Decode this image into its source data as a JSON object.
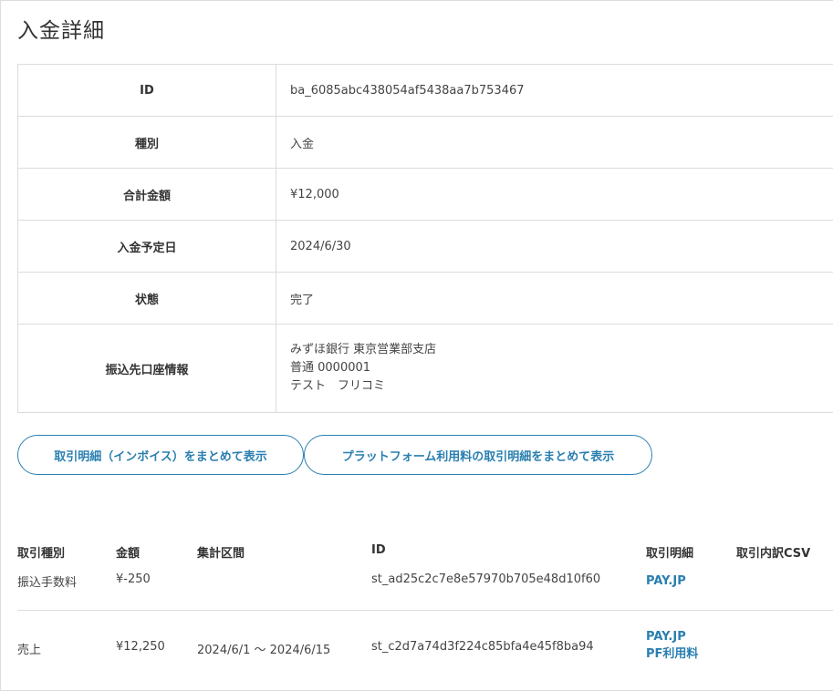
{
  "page": {
    "title": "入金詳細"
  },
  "details": {
    "id_label": "ID",
    "id_value": "ba_6085abc438054af5438aa7b753467",
    "type_label": "種別",
    "type_value": "入金",
    "total_label": "合計金額",
    "total_value": "¥12,000",
    "date_label": "入金予定日",
    "date_value": "2024/6/30",
    "status_label": "状態",
    "status_value": "完了",
    "account_label": "振込先口座情報",
    "account_bank": "みずほ銀行 東京営業部支店",
    "account_number": "普通 0000001",
    "account_holder": "テスト　フリコミ"
  },
  "buttons": {
    "invoice_label": "取引明細（インボイス）をまとめて表示",
    "platform_label": "プラットフォーム利用料の取引明細をまとめて表示"
  },
  "transactions": {
    "headers": {
      "type": "取引種別",
      "amount": "金額",
      "period": "集計区間",
      "id": "ID",
      "detail": "取引明細",
      "csv": "取引内訳CSV"
    },
    "rows": [
      {
        "type": "振込手数料",
        "amount": "¥-250",
        "period": "",
        "id": "st_ad25c2c7e8e57970b705e48d10f60",
        "detail_link1": "PAY.JP",
        "detail_link2": ""
      },
      {
        "type": "売上",
        "amount": "¥12,250",
        "period": "2024/6/1 〜 2024/6/15",
        "id": "st_c2d7a74d3f224c85bfa4e45f8ba94",
        "detail_link1": "PAY.JP",
        "detail_link2": "PF利用料"
      }
    ]
  },
  "colors": {
    "accent": "#2a7fb0",
    "border": "#dcdcdc",
    "text": "#333333"
  }
}
